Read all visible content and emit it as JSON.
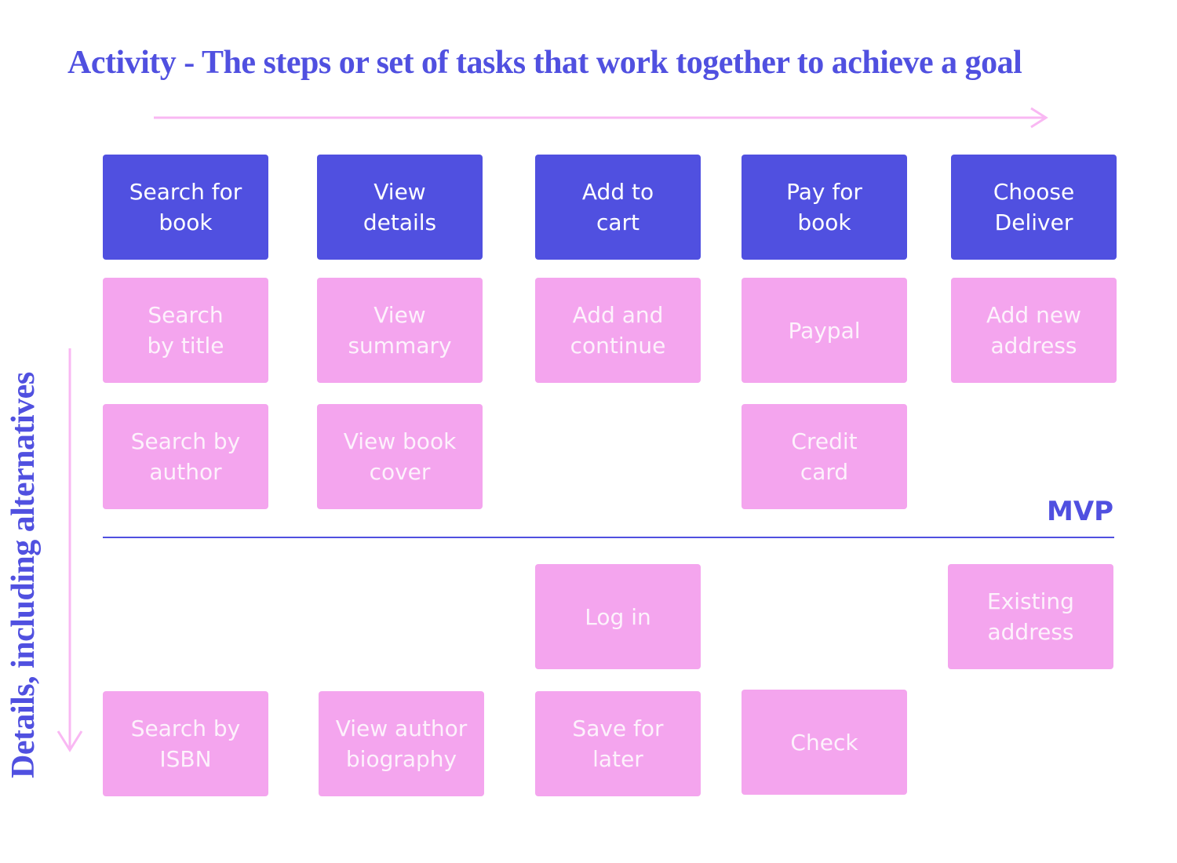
{
  "title": "Activity - The steps or set of tasks that work together to achieve a goal",
  "side_label": "Details, including alternatives",
  "mvp_label": "MVP",
  "colors": {
    "activity": "#5050e0",
    "detail": "#f4a5ee",
    "arrow": "#f9b8f3",
    "text_accent": "#5050e0"
  },
  "activities": [
    {
      "label": "Search for\nbook"
    },
    {
      "label": "View\ndetails"
    },
    {
      "label": "Add to\ncart"
    },
    {
      "label": "Pay for\nbook"
    },
    {
      "label": "Choose\nDeliver"
    }
  ],
  "details_mvp": [
    {
      "label": "Search\nby title"
    },
    {
      "label": "View\nsummary"
    },
    {
      "label": "Add and\ncontinue"
    },
    {
      "label": "Paypal"
    },
    {
      "label": "Add new\naddress"
    },
    {
      "label": "Search by\nauthor"
    },
    {
      "label": "View book\ncover"
    },
    {
      "label": "Credit\ncard"
    }
  ],
  "details_later": [
    {
      "label": "Log in"
    },
    {
      "label": "Existing\naddress"
    },
    {
      "label": "Search by\nISBN"
    },
    {
      "label": "View author\nbiography"
    },
    {
      "label": "Save for\nlater"
    },
    {
      "label": "Check"
    }
  ]
}
